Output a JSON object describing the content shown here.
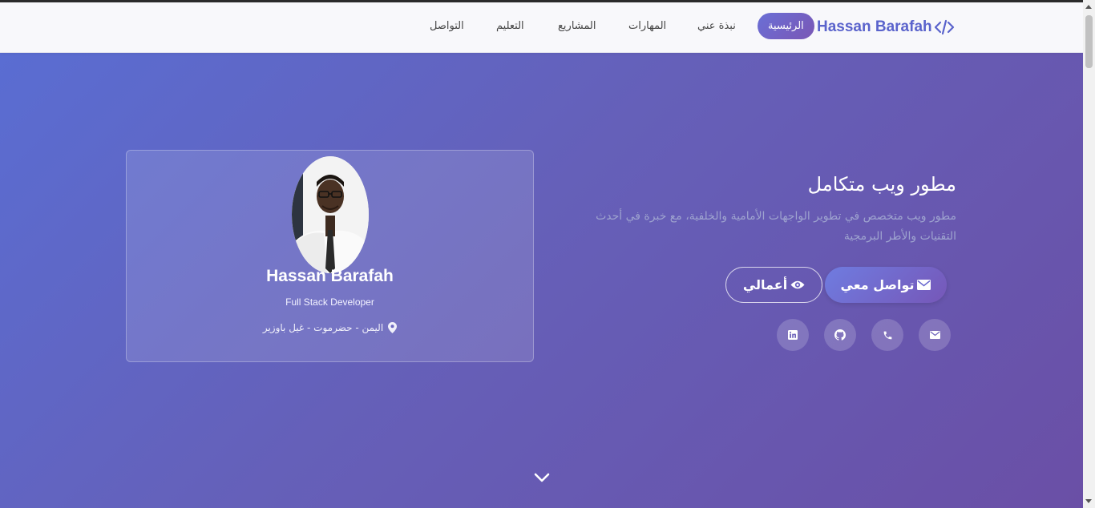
{
  "nav": {
    "brand": "Hassan Barafah",
    "brand_icon": "code-icon",
    "items": [
      {
        "label": "الرئيسية",
        "active": true
      },
      {
        "label": "نبذة عني",
        "active": false
      },
      {
        "label": "المهارات",
        "active": false
      },
      {
        "label": "المشاريع",
        "active": false
      },
      {
        "label": "التعليم",
        "active": false
      },
      {
        "label": "التواصل",
        "active": false
      }
    ]
  },
  "hero": {
    "title": "مطور ويب متكامل",
    "description": "مطور ويب متخصص في تطوير الواجهات الأمامية والخلفية، مع خبرة في أحدث التقنيات والأطر البرمجية",
    "buttons": {
      "contact": {
        "label": "تواصل معي",
        "icon": "envelope-icon"
      },
      "work": {
        "label": "أعمالي",
        "icon": "eye-icon"
      }
    },
    "socials": [
      "email-icon",
      "phone-icon",
      "github-icon",
      "linkedin-icon"
    ]
  },
  "profile": {
    "name": "Hassan Barafah",
    "role": "Full Stack Developer",
    "location": "اليمن - حضرموت - غيل باوزير",
    "location_icon": "map-pin-icon"
  },
  "scroll": {
    "icon": "chevron-down-icon"
  },
  "colors": {
    "accent": "#5a63cc",
    "gradient_start": "#5a6dd2",
    "gradient_end": "#6a4fa6",
    "nav_bg": "#f8f8fb"
  }
}
